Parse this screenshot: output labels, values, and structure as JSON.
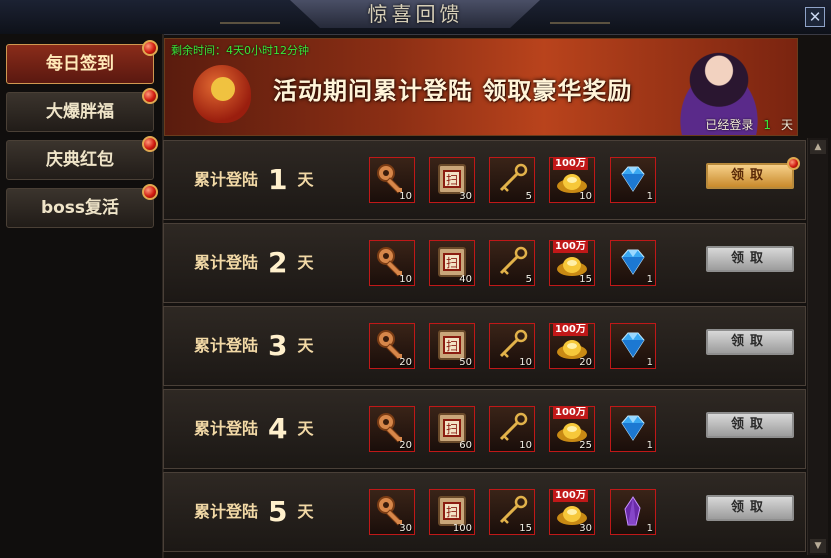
{
  "window": {
    "title": "惊喜回馈",
    "close_symbol": "✕"
  },
  "sidebar": {
    "items": [
      {
        "label": "每日签到",
        "active": true
      },
      {
        "label": "大爆胖福",
        "active": false
      },
      {
        "label": "庆典红包",
        "active": false
      },
      {
        "label": "boss复活",
        "active": false
      }
    ]
  },
  "banner": {
    "remaining_time": "剩余时间：4天0小时12分钟",
    "headline": "活动期间累计登陆  领取豪华奖励",
    "logged_prefix": "已经登录",
    "logged_days": "1",
    "logged_suffix": "天"
  },
  "rows": [
    {
      "label_prefix": "累计登陆",
      "day": "1",
      "label_suffix": "天",
      "claim_label": "领取",
      "claimable": true,
      "rewards": [
        {
          "icon": "bronze-key-icon",
          "count": "10"
        },
        {
          "icon": "sweep-scroll-icon",
          "count": "30"
        },
        {
          "icon": "gold-key-icon",
          "count": "5"
        },
        {
          "icon": "gold-ingot-icon",
          "badge": "100万",
          "count": "10"
        },
        {
          "icon": "blue-diamond-icon",
          "count": "1"
        }
      ]
    },
    {
      "label_prefix": "累计登陆",
      "day": "2",
      "label_suffix": "天",
      "claim_label": "领取",
      "claimable": false,
      "rewards": [
        {
          "icon": "bronze-key-icon",
          "count": "10"
        },
        {
          "icon": "sweep-scroll-icon",
          "count": "40"
        },
        {
          "icon": "gold-key-icon",
          "count": "5"
        },
        {
          "icon": "gold-ingot-icon",
          "badge": "100万",
          "count": "15"
        },
        {
          "icon": "blue-diamond-icon",
          "count": "1"
        }
      ]
    },
    {
      "label_prefix": "累计登陆",
      "day": "3",
      "label_suffix": "天",
      "claim_label": "领取",
      "claimable": false,
      "rewards": [
        {
          "icon": "bronze-key-icon",
          "count": "20"
        },
        {
          "icon": "sweep-scroll-icon",
          "count": "50"
        },
        {
          "icon": "gold-key-icon",
          "count": "10"
        },
        {
          "icon": "gold-ingot-icon",
          "badge": "100万",
          "count": "20"
        },
        {
          "icon": "blue-diamond-icon",
          "count": "1"
        }
      ]
    },
    {
      "label_prefix": "累计登陆",
      "day": "4",
      "label_suffix": "天",
      "claim_label": "领取",
      "claimable": false,
      "rewards": [
        {
          "icon": "bronze-key-icon",
          "count": "20"
        },
        {
          "icon": "sweep-scroll-icon",
          "count": "60"
        },
        {
          "icon": "gold-key-icon",
          "count": "10"
        },
        {
          "icon": "gold-ingot-icon",
          "badge": "100万",
          "count": "25"
        },
        {
          "icon": "blue-diamond-icon",
          "count": "1"
        }
      ]
    },
    {
      "label_prefix": "累计登陆",
      "day": "5",
      "label_suffix": "天",
      "claim_label": "领取",
      "claimable": false,
      "rewards": [
        {
          "icon": "bronze-key-icon",
          "count": "30"
        },
        {
          "icon": "sweep-scroll-icon",
          "count": "100"
        },
        {
          "icon": "gold-key-icon",
          "count": "15"
        },
        {
          "icon": "gold-ingot-icon",
          "badge": "100万",
          "count": "30"
        },
        {
          "icon": "purple-crystal-icon",
          "count": "1"
        }
      ]
    }
  ],
  "colors": {
    "accent_gold": "#f6d08a",
    "active_red": "#8a2c1a",
    "green_text": "#39e839",
    "slot_border": "#c01818"
  }
}
